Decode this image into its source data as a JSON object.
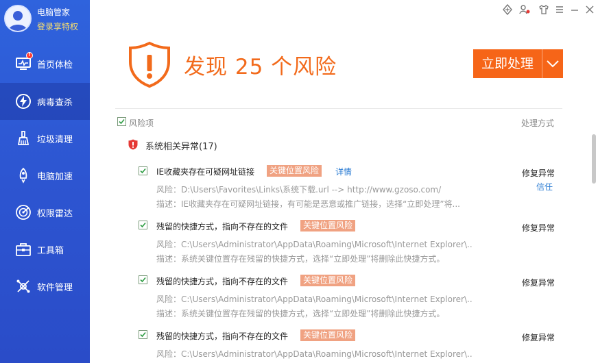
{
  "user": {
    "app_name": "电脑管家",
    "login_text": "登录享特权"
  },
  "nav": {
    "items": [
      {
        "label": "首页体检",
        "icon": "monitor-icon"
      },
      {
        "label": "病毒查杀",
        "icon": "lightning-icon"
      },
      {
        "label": "垃圾清理",
        "icon": "broom-icon"
      },
      {
        "label": "电脑加速",
        "icon": "rocket-icon"
      },
      {
        "label": "权限雷达",
        "icon": "radar-icon"
      },
      {
        "label": "工具箱",
        "icon": "toolbox-icon"
      },
      {
        "label": "软件管理",
        "icon": "software-icon"
      }
    ],
    "active_index": 1
  },
  "window_controls": [
    "skin-icon",
    "user-switch-icon",
    "shirt-icon",
    "menu-icon",
    "minimize-icon",
    "close-icon"
  ],
  "header": {
    "headline": "发现 25 个风险",
    "fix_button_label": "立即处理"
  },
  "columns": {
    "risk": "风险项",
    "action": "处理方式"
  },
  "group": {
    "title": "系统相关异常(17)"
  },
  "items": [
    {
      "title": "IE收藏夹存在可疑网址链接",
      "tag": "关键位置风险",
      "detail_link": "详情",
      "risk_line": "风险：D:\\Users\\Favorites\\Links\\系统下载.url --> http://www.gzoso.com/",
      "desc_line": "描述：IE收藏夹存在可疑网址链接，有可能是恶意或推广链接，选择“立即处理”将...",
      "action": "修复异常",
      "trust": "信任"
    },
    {
      "title": "残留的快捷方式，指向不存在的文件",
      "tag": "关键位置风险",
      "risk_line": "风险：C:\\Users\\Administrator\\AppData\\Roaming\\Microsoft\\Internet Explorer\\...",
      "desc_line": "描述：系统关键位置存在残留的快捷方式，选择“立即处理”将删除此快捷方式。",
      "action": "修复异常"
    },
    {
      "title": "残留的快捷方式，指向不存在的文件",
      "tag": "关键位置风险",
      "risk_line": "风险：C:\\Users\\Administrator\\AppData\\Roaming\\Microsoft\\Internet Explorer\\...",
      "desc_line": "描述：系统关键位置存在残留的快捷方式，选择“立即处理”将删除此快捷方式。",
      "action": "修复异常"
    },
    {
      "title": "残留的快捷方式，指向不存在的文件",
      "tag": "关键位置风险",
      "risk_line": "风险：C:\\Users\\Administrator\\AppData\\Roaming\\Microsoft\\Internet Explorer\\...",
      "action": "修复异常"
    }
  ],
  "colors": {
    "sidebar": "#2d55d1",
    "accent_orange": "#f66518",
    "headline": "#f26a1b",
    "tag": "#f0a282",
    "link": "#2b7cd3",
    "check": "#2f9e44"
  }
}
